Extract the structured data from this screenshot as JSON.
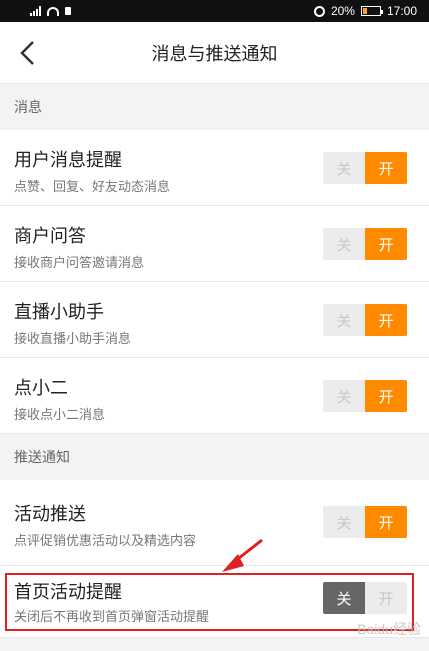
{
  "status_bar": {
    "battery": "20%",
    "time": "17:00",
    "icons": [
      "signal-icon",
      "wifi-icon",
      "lock-icon",
      "alarm-icon",
      "battery-icon"
    ]
  },
  "header": {
    "title": "消息与推送通知",
    "back_icon": "back-arrow-icon"
  },
  "sections": [
    {
      "label": "消息",
      "items": [
        {
          "title": "用户消息提醒",
          "subtitle": "点赞、回复、好友动态消息",
          "off_label": "关",
          "on_label": "开",
          "state": "on"
        },
        {
          "title": "商户问答",
          "subtitle": "接收商户问答邀请消息",
          "off_label": "关",
          "on_label": "开",
          "state": "on"
        },
        {
          "title": "直播小助手",
          "subtitle": "接收直播小助手消息",
          "off_label": "关",
          "on_label": "开",
          "state": "on"
        },
        {
          "title": "点小二",
          "subtitle": "接收点小二消息",
          "off_label": "关",
          "on_label": "开",
          "state": "on"
        }
      ]
    },
    {
      "label": "推送通知",
      "items": [
        {
          "title": "活动推送",
          "subtitle": "点评促销优惠活动以及精选内容",
          "off_label": "关",
          "on_label": "开",
          "state": "on"
        },
        {
          "title": "首页活动提醒",
          "subtitle": "关闭后不再收到首页弹窗活动提醒",
          "off_label": "关",
          "on_label": "开",
          "state": "off"
        }
      ]
    }
  ],
  "annotation": {
    "color": "#e02020"
  },
  "colors": {
    "accent": "#ff8a00",
    "off_active": "#666666",
    "toggle_inactive": "#ececec"
  },
  "watermark": "Baidu经验"
}
